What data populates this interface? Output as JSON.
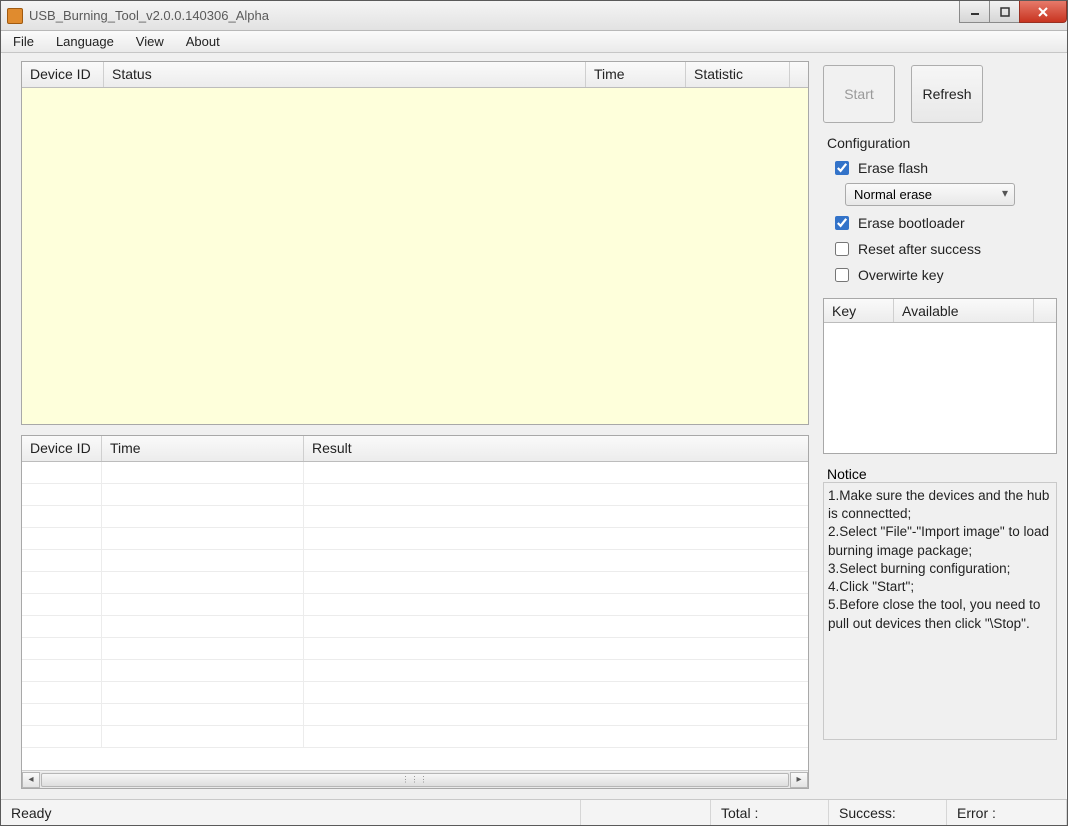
{
  "window": {
    "title": "USB_Burning_Tool_v2.0.0.140306_Alpha"
  },
  "menu": {
    "file": "File",
    "language": "Language",
    "view": "View",
    "about": "About"
  },
  "deviceGrid": {
    "headers": {
      "deviceId": "Device ID",
      "status": "Status",
      "time": "Time",
      "statistic": "Statistic"
    }
  },
  "resultGrid": {
    "headers": {
      "deviceId": "Device ID",
      "time": "Time",
      "result": "Result"
    }
  },
  "buttons": {
    "start": "Start",
    "refresh": "Refresh"
  },
  "config": {
    "title": "Configuration",
    "eraseFlash": {
      "label": "Erase flash",
      "checked": true
    },
    "eraseModeSelected": "Normal erase",
    "eraseBootloader": {
      "label": "Erase bootloader",
      "checked": true
    },
    "resetAfterSuccess": {
      "label": "Reset after success",
      "checked": false
    },
    "overwriteKey": {
      "label": "Overwirte key",
      "checked": false
    }
  },
  "keyGrid": {
    "headers": {
      "key": "Key",
      "available": "Available"
    }
  },
  "notice": {
    "title": "Notice",
    "lines": [
      "1.Make sure the devices and the hub is connectted;",
      "2.Select \"File\"-\"Import image\" to load burning image package;",
      "3.Select burning configuration;",
      "4.Click \"Start\";",
      "5.Before close the tool, you need to pull out devices then click \"\\Stop\"."
    ]
  },
  "status": {
    "ready": "Ready",
    "total": "Total :",
    "success": "Success:",
    "error": "Error :"
  }
}
